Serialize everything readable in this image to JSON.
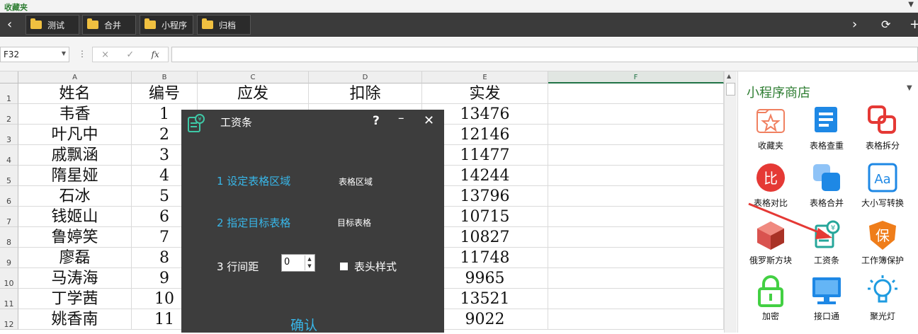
{
  "favorites": {
    "title": "收藏夹",
    "items": [
      {
        "label": "测试"
      },
      {
        "label": "合并"
      },
      {
        "label": "小程序"
      },
      {
        "label": "归档"
      }
    ]
  },
  "formula_bar": {
    "name_box": "F32",
    "cancel": "×",
    "confirm": "✓",
    "fx": "fx",
    "content": ""
  },
  "sheet": {
    "columns": [
      "A",
      "B",
      "C",
      "D",
      "E",
      "F"
    ],
    "selected_column": "F",
    "rows": [
      {
        "num": "1",
        "cells": [
          "姓名",
          "编号",
          "应发",
          "扣除",
          "实发"
        ]
      },
      {
        "num": "2",
        "cells": [
          "韦香",
          "1",
          "",
          "",
          "13476"
        ]
      },
      {
        "num": "3",
        "cells": [
          "叶凡中",
          "2",
          "",
          "",
          "12146"
        ]
      },
      {
        "num": "4",
        "cells": [
          "戚飘涵",
          "3",
          "",
          "",
          "11477"
        ]
      },
      {
        "num": "5",
        "cells": [
          "隋星娅",
          "4",
          "",
          "",
          "14244"
        ]
      },
      {
        "num": "6",
        "cells": [
          "石冰",
          "5",
          "",
          "",
          "13796"
        ]
      },
      {
        "num": "7",
        "cells": [
          "钱姬山",
          "6",
          "",
          "",
          "10715"
        ]
      },
      {
        "num": "8",
        "cells": [
          "鲁婷笑",
          "7",
          "",
          "",
          "10827"
        ]
      },
      {
        "num": "9",
        "cells": [
          "廖磊",
          "8",
          "",
          "",
          "11748"
        ]
      },
      {
        "num": "10",
        "cells": [
          "马涛海",
          "9",
          "",
          "",
          "9965"
        ]
      },
      {
        "num": "11",
        "cells": [
          "丁学茜",
          "10",
          "",
          "",
          "13521"
        ]
      },
      {
        "num": "12",
        "cells": [
          "姚香南",
          "11",
          "",
          "",
          "9022"
        ]
      }
    ]
  },
  "dialog": {
    "title": "工资条",
    "help": "?",
    "minimize": "–",
    "close": "✕",
    "step1_label": "1  设定表格区域",
    "step1_value": "表格区域",
    "step2_label": "2  指定目标表格",
    "step2_value": "目标表格",
    "step3_label": "3  行间距",
    "spacing_value": "0",
    "header_style_label": "表头样式",
    "confirm": "确认"
  },
  "store": {
    "title": "小程序商店",
    "apps": [
      {
        "name": "收藏夹",
        "icon": "star-folder-icon",
        "color": "#f08060"
      },
      {
        "name": "表格查重",
        "icon": "doc-lines-icon",
        "color": "#1e88e5"
      },
      {
        "name": "表格拆分",
        "icon": "split-squares-icon",
        "color": "#e53935"
      },
      {
        "name": "表格对比",
        "icon": "compare-badge-icon",
        "color": "#e53935"
      },
      {
        "name": "表格合并",
        "icon": "merge-squares-icon",
        "color": "#1e88e5"
      },
      {
        "name": "大小写转换",
        "icon": "case-convert-icon",
        "color": "#1e88e5"
      },
      {
        "name": "俄罗斯方块",
        "icon": "cube-icon",
        "color": "#c0392b"
      },
      {
        "name": "工资条",
        "icon": "payslip-icon",
        "color": "#26a69a"
      },
      {
        "name": "工作簿保护",
        "icon": "shield-icon",
        "color": "#ef7d1a"
      },
      {
        "name": "加密",
        "icon": "lock-icon",
        "color": "#43d043"
      },
      {
        "name": "接口通",
        "icon": "monitor-icon",
        "color": "#1e88e5"
      },
      {
        "name": "聚光灯",
        "icon": "bulb-icon",
        "color": "#1e9be0"
      }
    ]
  }
}
